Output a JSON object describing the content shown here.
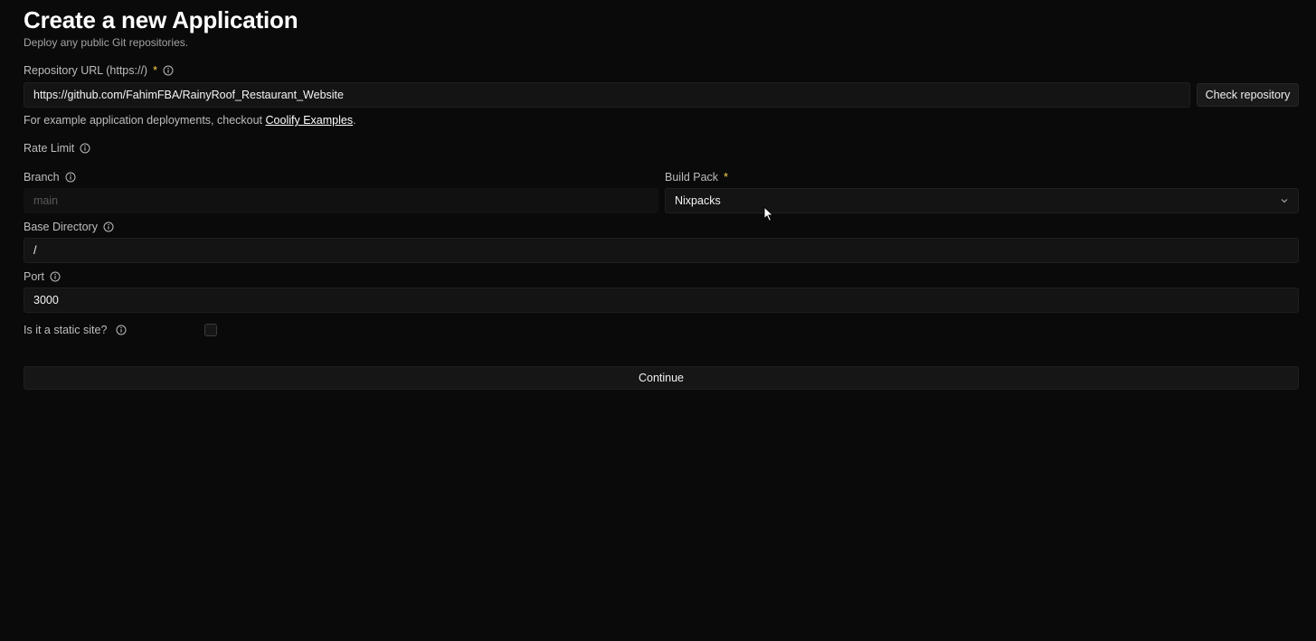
{
  "header": {
    "title": "Create a new Application",
    "subtitle": "Deploy any public Git repositories."
  },
  "repository": {
    "label": "Repository URL (https://)",
    "required_mark": "*",
    "value": "https://github.com/FahimFBA/RainyRoof_Restaurant_Website",
    "check_button_label": "Check repository"
  },
  "helper": {
    "prefix": "For example application deployments, checkout ",
    "link_label": "Coolify Examples",
    "suffix": "."
  },
  "rate_limit": {
    "label": "Rate Limit"
  },
  "branch": {
    "label": "Branch",
    "placeholder": "main"
  },
  "build_pack": {
    "label": "Build Pack",
    "required_mark": "*",
    "selected": "Nixpacks"
  },
  "base_directory": {
    "label": "Base Directory",
    "value": "/"
  },
  "port": {
    "label": "Port",
    "value": "3000"
  },
  "static_site": {
    "label": "Is it a static site?",
    "checked": false
  },
  "actions": {
    "continue_label": "Continue"
  },
  "icons": {
    "info": "info-circle-icon",
    "chevron": "chevron-down-icon",
    "cursor": "mouse-pointer-icon"
  },
  "colors": {
    "background": "#0a0a0a",
    "required_mark": "#fcd34d",
    "input_bg": "#141414"
  }
}
